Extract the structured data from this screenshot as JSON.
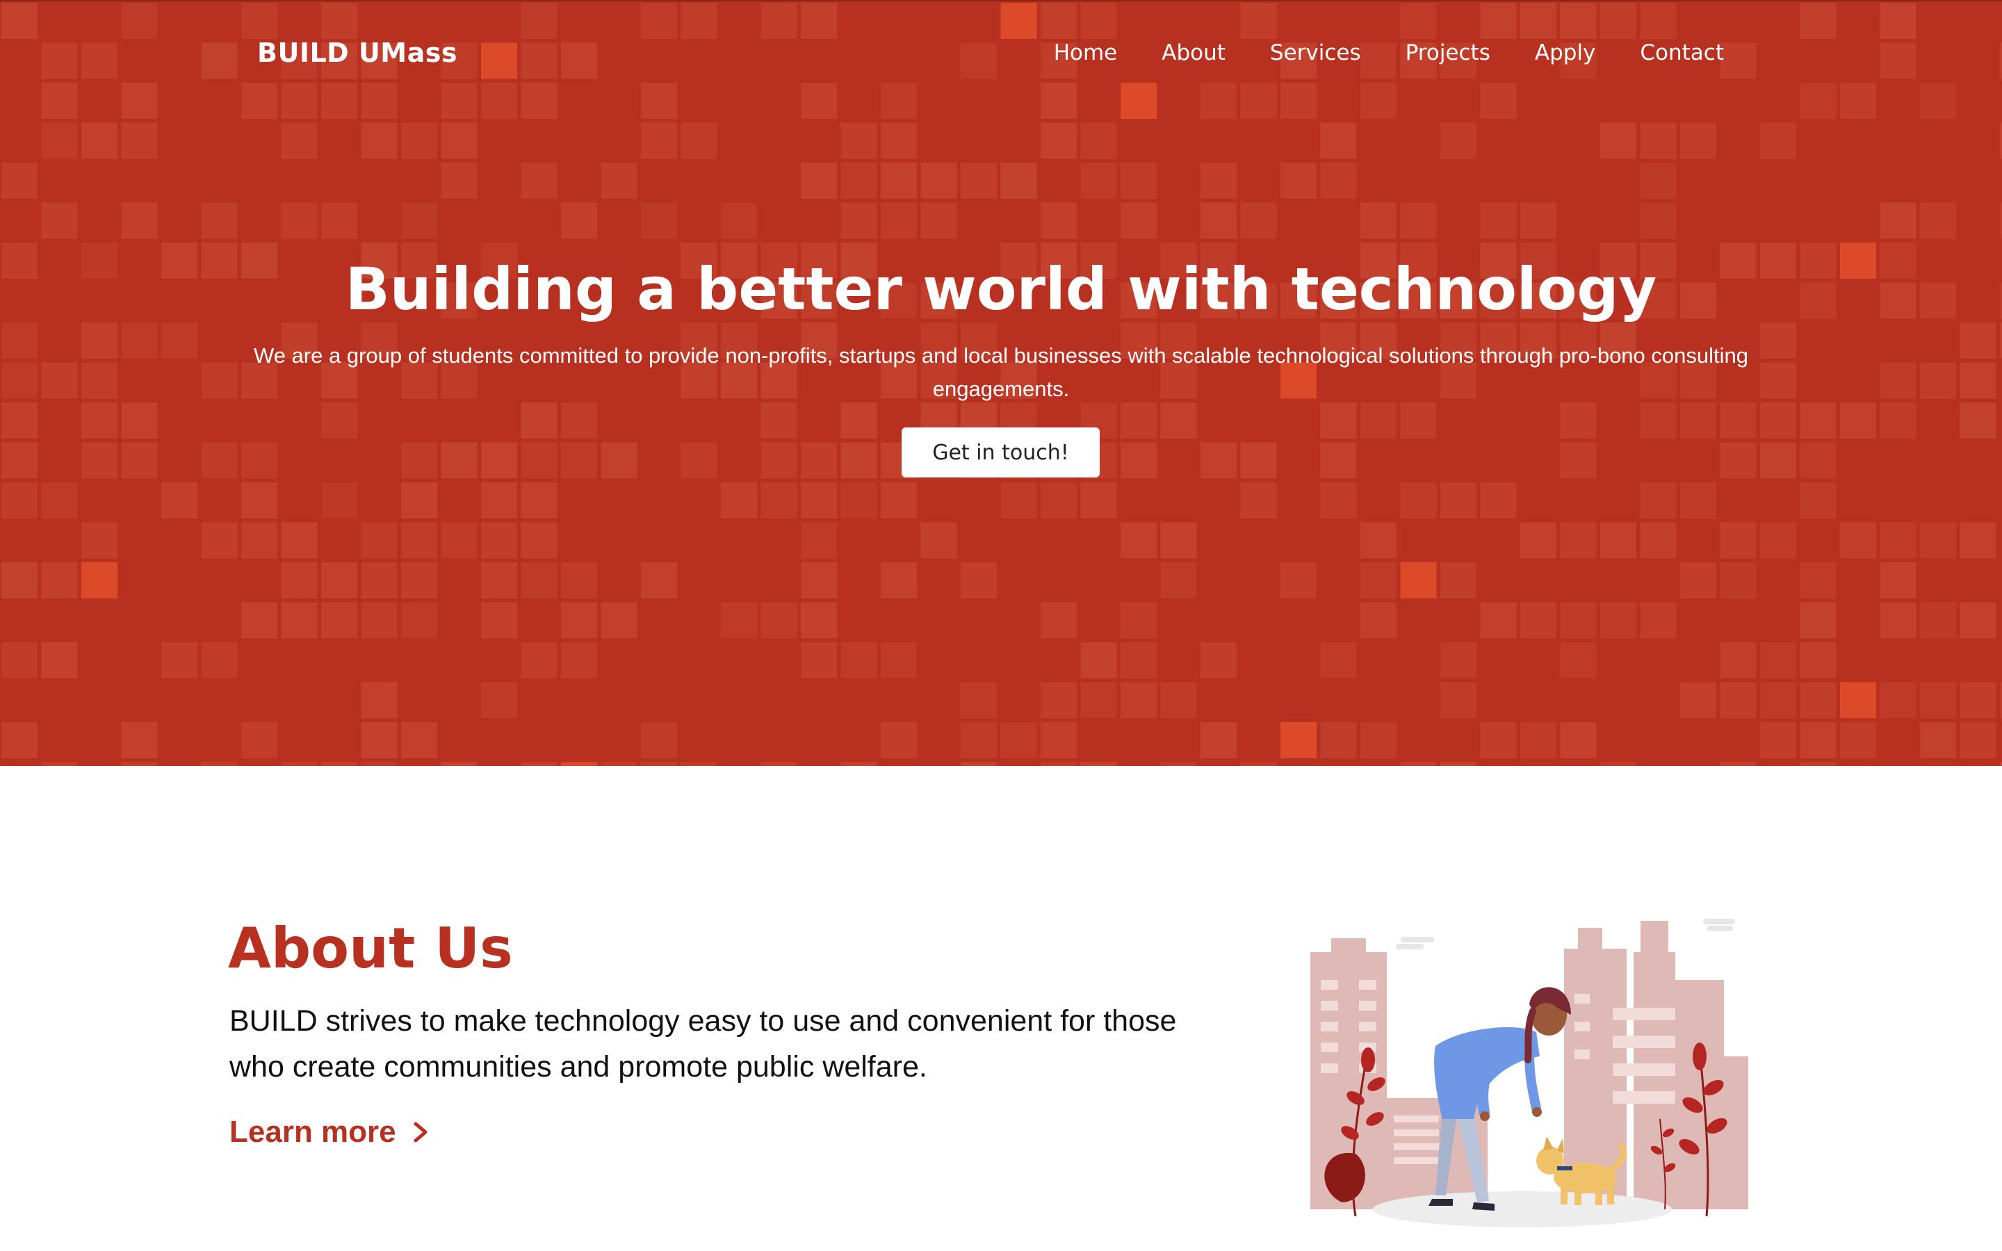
{
  "brand": {
    "name": "BUILD UMass"
  },
  "nav": {
    "items": [
      {
        "label": "Home"
      },
      {
        "label": "About"
      },
      {
        "label": "Services"
      },
      {
        "label": "Projects"
      },
      {
        "label": "Apply"
      },
      {
        "label": "Contact"
      }
    ]
  },
  "hero": {
    "title": "Building a better world with technology",
    "subtitle": "We are a group of students committed to provide non-profits, startups and local businesses with scalable technological solutions through pro-bono consulting engagements.",
    "cta_label": "Get in touch!"
  },
  "about": {
    "title": "About Us",
    "body": "BUILD strives to make technology easy to use and convenient for those who create communities and promote public welfare.",
    "link_label": "Learn more",
    "link_icon": "chevron-right-icon",
    "illustration_icon": "woman-petting-dog-city-illustration"
  },
  "colors": {
    "brand_red": "#b8301f",
    "hero_tile_light": "#c4432f",
    "hero_tile_accent": "#dc4a2a",
    "text_dark": "#111111",
    "white": "#ffffff"
  }
}
